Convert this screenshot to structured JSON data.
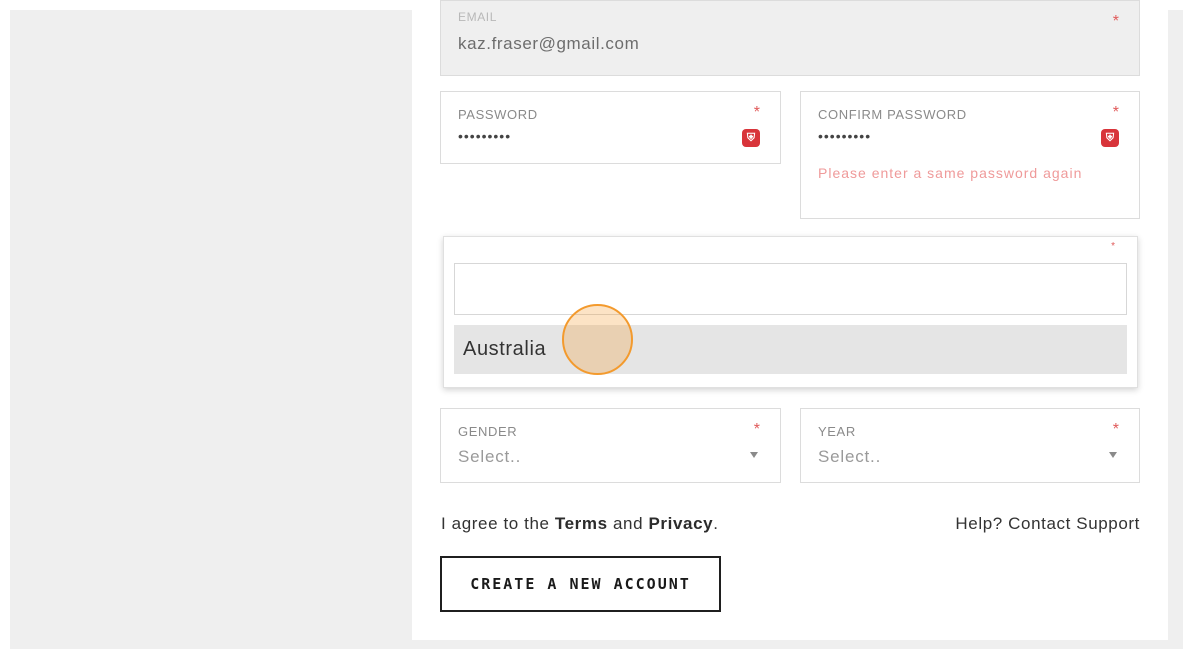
{
  "form": {
    "email": {
      "label": "EMAIL",
      "value": "kaz.fraser@gmail.com",
      "required": "*"
    },
    "password": {
      "label": "PASSWORD",
      "value": "•••••••••",
      "required": "*",
      "icon_glyph": "⛨"
    },
    "confirm_password": {
      "label": "CONFIRM PASSWORD",
      "value": "•••••••••",
      "required": "*",
      "icon_glyph": "⛨",
      "error": "Please enter a same password again"
    },
    "country_dropdown": {
      "required": "*",
      "search_value": "",
      "options": [
        "Australia"
      ]
    },
    "gender": {
      "label": "GENDER",
      "placeholder": "Select..",
      "required": "*"
    },
    "year": {
      "label": "YEAR",
      "placeholder": "Select..",
      "required": "*"
    },
    "agree": {
      "prefix": "I agree to the ",
      "terms": "Terms",
      "and": " and ",
      "privacy": "Privacy",
      "suffix": "."
    },
    "help_link": "Help? Contact Support",
    "create_button": "CREATE A NEW ACCOUNT"
  },
  "colors": {
    "required": "#e05a5a",
    "error": "#ef9a9a",
    "shield_icon": "#d8343a",
    "click_indicator": "#f39a2d"
  },
  "icons": {
    "password_visibility": "shield-icon",
    "confirm_visibility": "shield-icon",
    "select_caret": "chevron-down-icon"
  }
}
